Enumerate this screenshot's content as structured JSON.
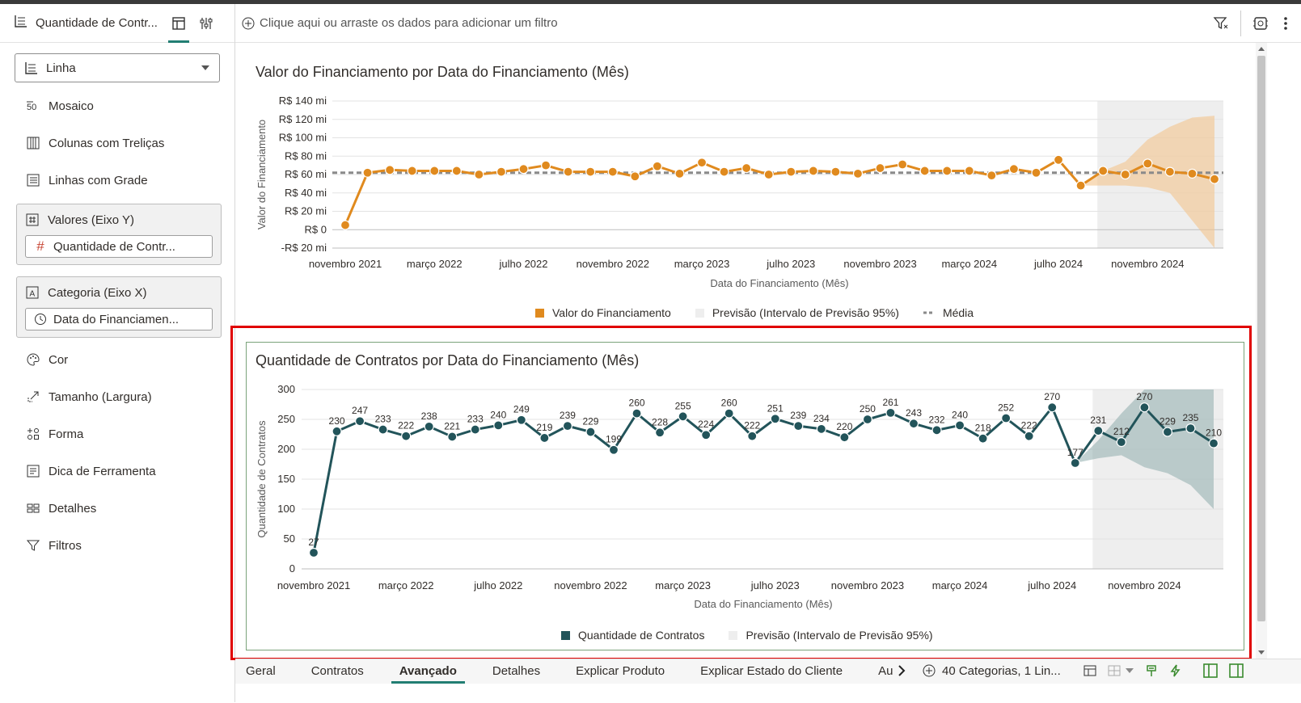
{
  "left_panel": {
    "title": "Quantidade de Contr...",
    "chart_type_select": "Linha",
    "items": {
      "mosaico": "Mosaico",
      "colunas": "Colunas com Treliças",
      "linhas": "Linhas com Grade",
      "cor": "Cor",
      "tamanho": "Tamanho (Largura)",
      "forma": "Forma",
      "dica": "Dica de Ferramenta",
      "detalhes": "Detalhes",
      "filtros": "Filtros"
    },
    "values_group": {
      "label": "Valores (Eixo Y)",
      "pill": "Quantidade de Contr..."
    },
    "category_group": {
      "label": "Categoria (Eixo X)",
      "pill": "Data do Financiamen..."
    }
  },
  "filter_bar": {
    "placeholder": "Clique aqui ou arraste os dados para adicionar um filtro"
  },
  "colors": {
    "accent": "#227e73",
    "orange": "#e08a1e",
    "teal": "#22545a",
    "forecast_band": "#eeeeee",
    "highlight": "#e00000"
  },
  "chart_data": [
    {
      "type": "line",
      "title": "Valor do Financiamento por Data do Financiamento (Mês)",
      "xlabel": "Data do Financiamento (Mês)",
      "ylabel": "Valor do Financiamento",
      "y_ticks": [
        "R$ 140 mi",
        "R$ 120 mi",
        "R$ 100 mi",
        "R$ 80 mi",
        "R$ 60 mi",
        "R$ 40 mi",
        "R$ 20 mi",
        "R$ 0",
        "-R$ 20 mi"
      ],
      "ylim": [
        -20,
        140
      ],
      "x_ticks": [
        "novembro 2021",
        "março 2022",
        "julho 2022",
        "novembro 2022",
        "março 2023",
        "julho 2023",
        "novembro 2023",
        "março 2024",
        "julho 2024",
        "novembro 2024"
      ],
      "x_tick_index": [
        0,
        4,
        8,
        12,
        16,
        20,
        24,
        28,
        32,
        36
      ],
      "average": 62,
      "values": [
        5,
        62,
        65,
        64,
        64,
        64,
        60,
        63,
        66,
        70,
        63,
        63,
        63,
        58,
        69,
        61,
        73,
        63,
        67,
        60,
        63,
        64,
        63,
        61,
        67,
        71,
        64,
        64,
        64,
        59,
        66,
        62,
        76,
        48
      ],
      "forecast": [
        64,
        60,
        72,
        63,
        61,
        55
      ],
      "forecast_upper": [
        64,
        74,
        98,
        112,
        122,
        124
      ],
      "forecast_lower": [
        48,
        48,
        46,
        40,
        10,
        -20
      ],
      "legend": [
        "Valor do Financiamento",
        "Previsão (Intervalo de Previsão 95%)",
        "Média"
      ]
    },
    {
      "type": "line",
      "title": "Quantidade de Contratos por Data do Financiamento (Mês)",
      "xlabel": "Data do Financiamento (Mês)",
      "ylabel": "Quantidade de Contratos",
      "y_ticks": [
        "300",
        "250",
        "200",
        "150",
        "100",
        "50",
        "0"
      ],
      "ylim": [
        0,
        300
      ],
      "x_ticks": [
        "novembro 2021",
        "março 2022",
        "julho 2022",
        "novembro 2022",
        "março 2023",
        "julho 2023",
        "novembro 2023",
        "março 2024",
        "julho 2024",
        "novembro 2024"
      ],
      "x_tick_index": [
        0,
        4,
        8,
        12,
        16,
        20,
        24,
        28,
        32,
        36
      ],
      "values": [
        27,
        230,
        247,
        233,
        222,
        238,
        221,
        233,
        240,
        249,
        219,
        239,
        229,
        199,
        260,
        228,
        255,
        224,
        260,
        222,
        251,
        239,
        234,
        220,
        250,
        261,
        243,
        232,
        240,
        218,
        252,
        222,
        270,
        177
      ],
      "labels": [
        "27",
        "230",
        "247",
        "233",
        "222",
        "238",
        "221",
        "233",
        "240",
        "249",
        "219",
        "239",
        "229",
        "199",
        "260",
        "228",
        "255",
        "224",
        "260",
        "222",
        "251",
        "239",
        "234",
        "220",
        "250",
        "261",
        "243",
        "232",
        "240",
        "218",
        "252",
        "222",
        "270",
        "177"
      ],
      "forecast": [
        231,
        212,
        270,
        229,
        235,
        210
      ],
      "forecast_labels": [
        "231",
        "212",
        "270",
        "229",
        "235",
        "210"
      ],
      "forecast_upper": [
        215,
        260,
        300,
        300,
        300,
        300
      ],
      "forecast_lower": [
        185,
        190,
        170,
        160,
        140,
        100
      ],
      "legend": [
        "Quantidade de Contratos",
        "Previsão (Intervalo de Previsão 95%)"
      ]
    }
  ],
  "bottom_tabs": [
    "Geral",
    "Contratos",
    "Avançado",
    "Detalhes",
    "Explicar Produto",
    "Explicar Estado do Cliente",
    "Au"
  ],
  "bottom_info": "40 Categorias, 1 Lin..."
}
